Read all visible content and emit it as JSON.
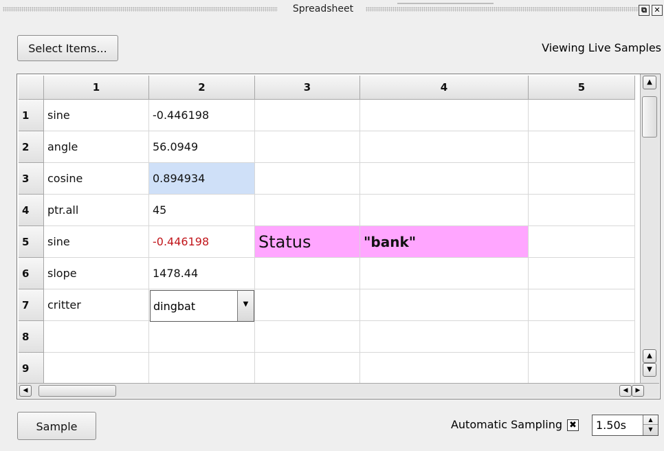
{
  "window": {
    "title": "Spreadsheet",
    "float_glyph": "⧉",
    "close_glyph": "✕"
  },
  "toolbar": {
    "select_items_label": "Select Items...",
    "status_text": "Viewing Live Samples"
  },
  "table": {
    "column_headers": [
      "1",
      "2",
      "3",
      "4",
      "5"
    ],
    "row_headers": [
      "1",
      "2",
      "3",
      "4",
      "5",
      "6",
      "7",
      "8",
      "9"
    ],
    "rows": [
      [
        "sine",
        "-0.446198",
        "",
        "",
        ""
      ],
      [
        "angle",
        "56.0949",
        "",
        "",
        ""
      ],
      [
        "cosine",
        "0.894934",
        "",
        "",
        ""
      ],
      [
        "ptr.all",
        " 45",
        "",
        "",
        ""
      ],
      [
        "sine",
        "-0.446198",
        "Status",
        "\"bank\"",
        ""
      ],
      [
        "slope",
        "1478.44",
        "",
        "",
        ""
      ],
      [
        "critter",
        "dingbat",
        "",
        "",
        ""
      ],
      [
        "",
        "",
        "",
        "",
        ""
      ],
      [
        "",
        "",
        "",
        "",
        ""
      ]
    ],
    "combo_value": "dingbat",
    "colors": {
      "selected_cell_bg": "#cfe0f8",
      "status_row_bg": "#ffa6ff",
      "negative_value_text": "#c1161b"
    }
  },
  "footer": {
    "sample_label": "Sample",
    "auto_sampling_label": "Automatic Sampling",
    "auto_sampling_checked": true,
    "interval_value": "1.50s"
  }
}
